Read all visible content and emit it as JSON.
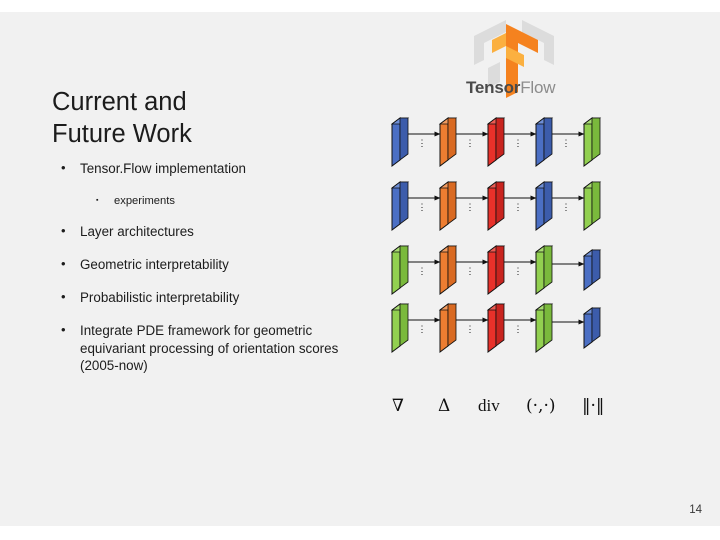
{
  "slide": {
    "title_lines": [
      "Current and",
      "Future Work"
    ],
    "page_number": "14",
    "bullets": [
      {
        "level": 1,
        "text": "Tensor.Flow implementation"
      },
      {
        "level": 2,
        "text": "experiments"
      },
      {
        "level": 1,
        "text": "Layer architectures"
      },
      {
        "level": 1,
        "text": "Geometric interpretability"
      },
      {
        "level": 1,
        "text": "Probabilistic interpretability"
      },
      {
        "level": 1,
        "text": "Integrate PDE framework for geometric equivariant processing of orientation scores (2005-now)"
      }
    ]
  },
  "logo": {
    "name": "tensorflow-logo",
    "wordmark_bold": "Tensor",
    "wordmark_light": "Flow",
    "colors": {
      "orange": "#f5821f",
      "light_orange": "#fbb040",
      "grey": "#d9d9d9"
    }
  },
  "diagram": {
    "name": "neural-network-layer-diagram",
    "ellipsis": "⋮",
    "colors": {
      "blue": "#4b6fc4",
      "light_blue": "#5b9bd5",
      "orange": "#ed7d31",
      "red": "#e8312a",
      "green": "#92d050",
      "edge": "#111111"
    },
    "rows": [
      {
        "row": 1,
        "plates": [
          {
            "color": "blue",
            "label": ""
          },
          {
            "color": "orange",
            "label": ""
          },
          {
            "color": "red",
            "label": ""
          },
          {
            "color": "blue",
            "label": ""
          },
          {
            "color": "green",
            "label": ""
          }
        ]
      },
      {
        "row": 2,
        "plates": [
          {
            "color": "blue",
            "label": ""
          },
          {
            "color": "orange",
            "label": ""
          },
          {
            "color": "red",
            "label": ""
          },
          {
            "color": "blue",
            "label": ""
          },
          {
            "color": "green",
            "label": ""
          }
        ]
      },
      {
        "row": 3,
        "plates": [
          {
            "color": "green",
            "label": ""
          },
          {
            "color": "orange",
            "label": ""
          },
          {
            "color": "red",
            "label": ""
          },
          {
            "color": "green",
            "label": ""
          },
          {
            "color": "blue",
            "label": ""
          }
        ]
      },
      {
        "row": 4,
        "plates": [
          {
            "color": "green",
            "label": ""
          },
          {
            "color": "orange",
            "label": ""
          },
          {
            "color": "red",
            "label": ""
          },
          {
            "color": "green",
            "label": ""
          },
          {
            "color": "blue",
            "label": ""
          }
        ]
      }
    ]
  },
  "operators": [
    {
      "name": "nabla",
      "symbol": "∇"
    },
    {
      "name": "laplacian",
      "symbol": "Δ"
    },
    {
      "name": "divergence",
      "symbol": "div"
    },
    {
      "name": "inner-product",
      "symbol": "(·,·)"
    },
    {
      "name": "norm",
      "symbol": "‖·‖"
    }
  ]
}
